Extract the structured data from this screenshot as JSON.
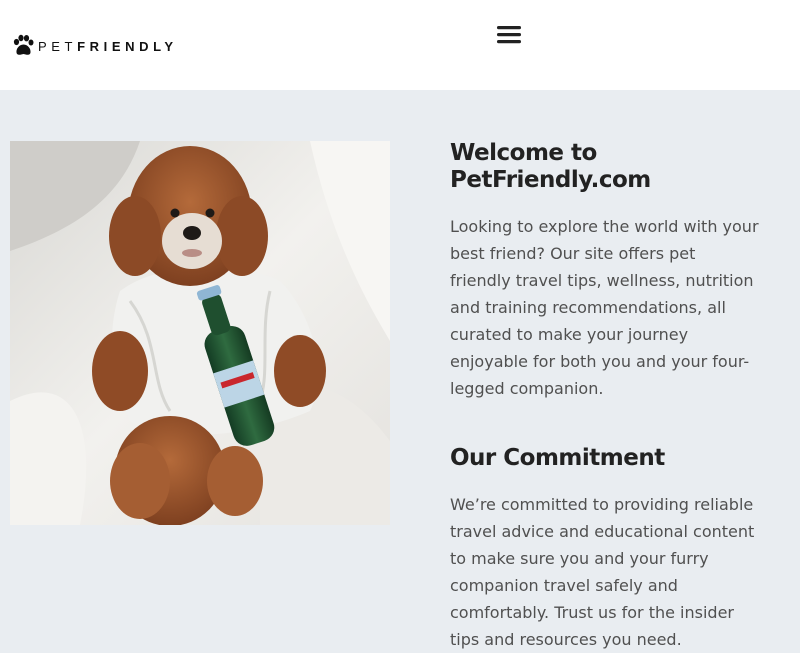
{
  "header": {
    "logo": {
      "icon": "paw-icon",
      "text_light": "PET",
      "text_bold": "FRIENDLY"
    },
    "menu_icon": "hamburger-menu-icon"
  },
  "hero": {
    "image": "dog-in-bathrobe-with-bottle-photo"
  },
  "welcome": {
    "title": "Welcome to PetFriendly.com",
    "body": "Looking to explore the world with your best friend? Our site offers pet friendly travel tips, wellness, nutrition and training recommendations, all curated to make your journey enjoyable for both you and your four-legged companion."
  },
  "commitment": {
    "title": "Our Commitment",
    "body": "We’re committed to providing reliable travel advice and educational content to make sure you and your furry companion travel safely and comfortably. Trust us for the insider tips and resources you need."
  },
  "colors": {
    "background": "#e9edf1",
    "header": "#ffffff",
    "heading": "#222222",
    "text": "#505050"
  }
}
